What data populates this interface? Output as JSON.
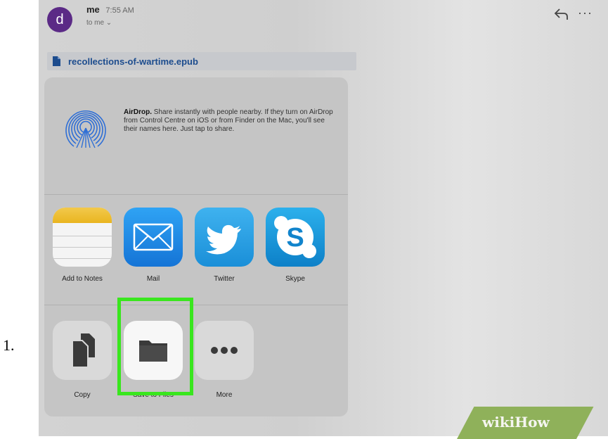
{
  "list_marker": "1.",
  "email": {
    "avatar_letter": "d",
    "sender": "me",
    "time": "7:55 AM",
    "recipient": "to me ⌄",
    "more_icon": "···"
  },
  "attachment": {
    "filename": "recollections-of-wartime.epub"
  },
  "airdrop": {
    "title": "AirDrop.",
    "description": "Share instantly with people nearby. If they turn on AirDrop from Control Centre on iOS or from Finder on the Mac, you'll see their names here. Just tap to share."
  },
  "apps": [
    {
      "label": "Add to Notes",
      "icon": "notes-icon"
    },
    {
      "label": "Mail",
      "icon": "mail-icon"
    },
    {
      "label": "Twitter",
      "icon": "twitter-icon"
    },
    {
      "label": "Skype",
      "icon": "skype-icon"
    }
  ],
  "actions": [
    {
      "label": "Copy",
      "icon": "copy-icon"
    },
    {
      "label": "Save to Files",
      "icon": "folder-icon",
      "highlighted": true
    },
    {
      "label": "More",
      "icon": "ellipsis-icon"
    }
  ],
  "colors": {
    "highlight": "#39e61e",
    "avatar": "#5b2a86",
    "link": "#1c4c8e"
  },
  "watermark": "wikiHow"
}
